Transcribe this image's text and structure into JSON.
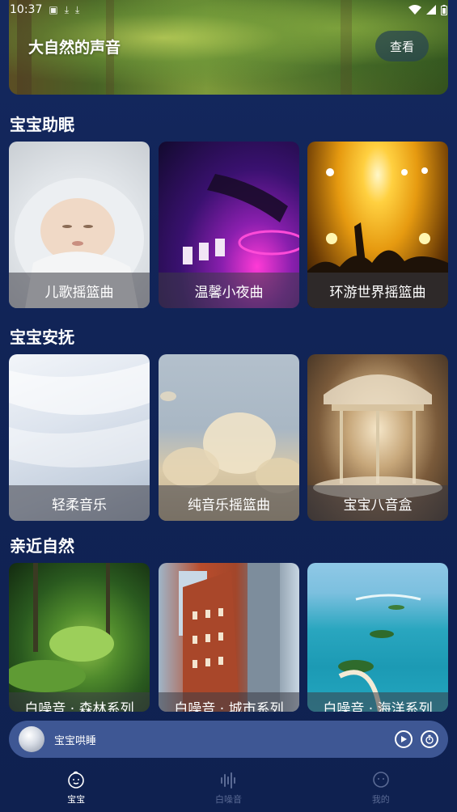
{
  "status_bar": {
    "time": "10:37",
    "left_icons": [
      "app-icon",
      "download-icon",
      "download-icon"
    ],
    "right_icons": [
      "wifi-icon",
      "signal-icon",
      "battery-icon"
    ]
  },
  "banner": {
    "title": "大自然的声音",
    "button_label": "查看"
  },
  "sections": [
    {
      "title": "宝宝助眠",
      "cards": [
        {
          "label": "儿歌摇篮曲",
          "image": "sleeping-baby"
        },
        {
          "label": "温馨小夜曲",
          "image": "dj-turntable"
        },
        {
          "label": "环游世界摇篮曲",
          "image": "concert-crowd"
        }
      ]
    },
    {
      "title": "宝宝安抚",
      "cards": [
        {
          "label": "轻柔音乐",
          "image": "white-feathers"
        },
        {
          "label": "纯音乐摇篮曲",
          "image": "pampas-grass"
        },
        {
          "label": "宝宝八音盒",
          "image": "glass-carousel"
        }
      ]
    },
    {
      "title": "亲近自然",
      "cards": [
        {
          "label": "白噪音 · 森林系列",
          "image": "forest"
        },
        {
          "label": "白噪音 · 城市系列",
          "image": "city-buildings"
        },
        {
          "label": "白噪音 · 海洋系列",
          "image": "ocean-islands"
        }
      ]
    }
  ],
  "player": {
    "title": "宝宝哄睡",
    "play_icon": "play-icon",
    "timer_icon": "timer-icon"
  },
  "bottom_nav": [
    {
      "label": "宝宝",
      "icon": "baby-face-icon",
      "active": true
    },
    {
      "label": "白噪音",
      "icon": "sound-wave-icon",
      "active": false
    },
    {
      "label": "我的",
      "icon": "smile-face-icon",
      "active": false
    }
  ],
  "colors": {
    "background": "#112457",
    "player_bar": "#3e5794",
    "nav_inactive": "#5a6a94"
  }
}
